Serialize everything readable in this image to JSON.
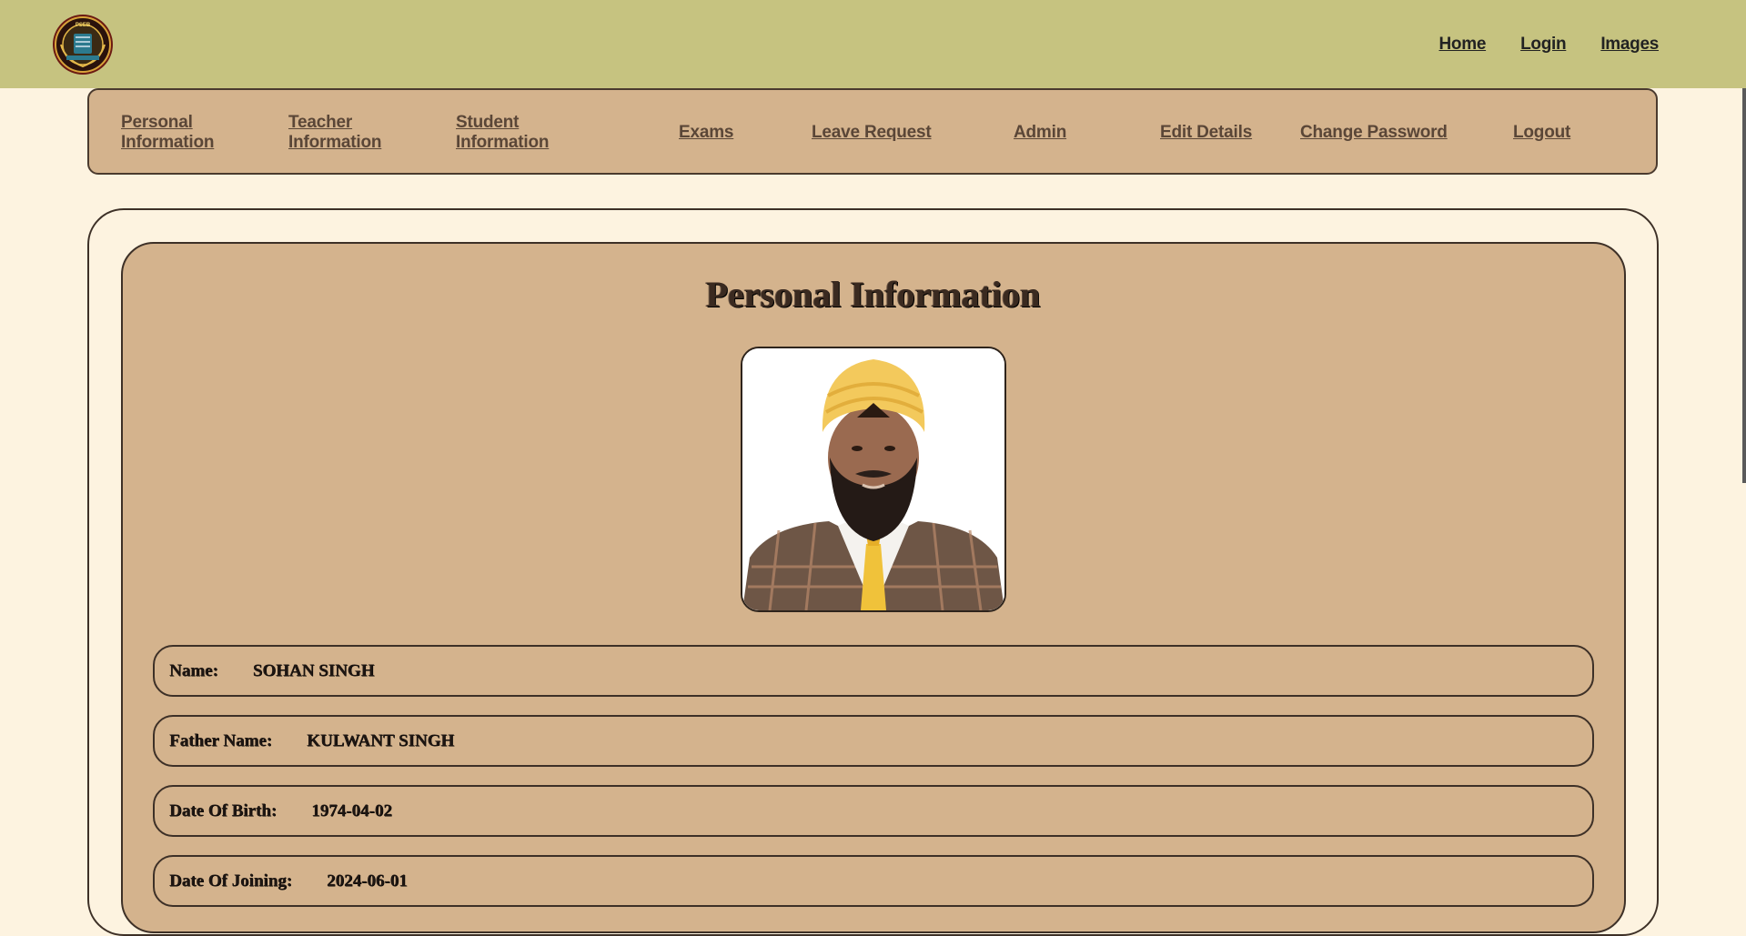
{
  "header": {
    "links": [
      "Home",
      "Login",
      "Images"
    ]
  },
  "nav": {
    "items": [
      {
        "label": "Personal Information"
      },
      {
        "label": "Teacher Information"
      },
      {
        "label": "Student Information"
      },
      {
        "label": "Exams"
      },
      {
        "label": "Leave Request"
      },
      {
        "label": "Admin"
      },
      {
        "label": "Edit Details"
      },
      {
        "label": "Change Password"
      },
      {
        "label": "Logout"
      }
    ]
  },
  "page": {
    "title": "Personal Information"
  },
  "fields": [
    {
      "label": "Name:",
      "value": "SOHAN SINGH"
    },
    {
      "label": "Father Name:",
      "value": "KULWANT SINGH"
    },
    {
      "label": "Date Of Birth:",
      "value": "1974-04-02"
    },
    {
      "label": "Date Of Joining:",
      "value": "2024-06-01"
    }
  ],
  "colors": {
    "topbar": "#c6c380",
    "background": "#fdf3e0",
    "card": "#d4b38d",
    "border": "#3d3027"
  },
  "icons": {
    "logo": "school-emblem-logo"
  }
}
